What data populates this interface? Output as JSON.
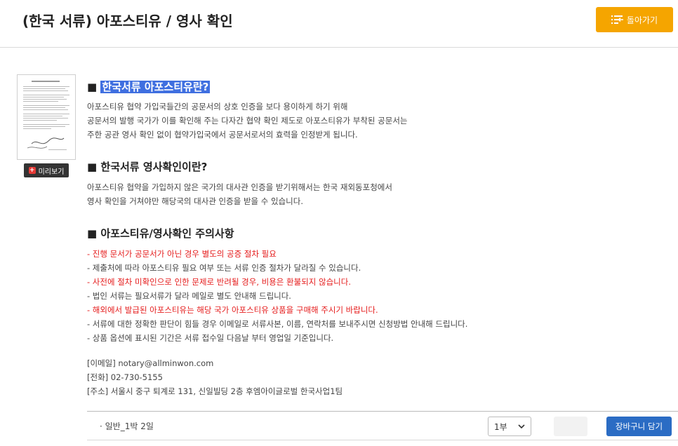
{
  "header": {
    "title": "(한국 서류) 아포스티유 / 영사 확인",
    "back_label": "돌아가기",
    "back_color": "#f5a500"
  },
  "thumbnail": {
    "preview_label": "미리보기",
    "icon": "document-thumbnail"
  },
  "sections": [
    {
      "title": "■ 한국서류 아포스티유란?",
      "title_prefix": "■ ",
      "title_highlight": "한국서류 아포스티유란?",
      "lines": [
        "아포스티유 협약 가입국들간의 공문서의 상호 인증을 보다 용이하게 하기 위해",
        "공문서의 발행 국가가 이를 확인해 주는 다자간 협약 확인 제도로 아포스티유가 부착된 공문서는",
        "주한 공관 영사 확인 없이 협약가입국에서 공문서로서의 효력을 인정받게 됩니다."
      ]
    },
    {
      "title": "■ 한국서류 영사확인이란?",
      "lines": [
        "아포스티유 협약을 가입하지 않은 국가의 대사관 인증을 받기위해서는 한국 재외동포청에서",
        "영사 확인을 거쳐야만 해당국의 대사관 인증을 받을 수 있습니다."
      ]
    },
    {
      "title": "■ 아포스티유/영사확인 주의사항"
    }
  ],
  "notes": [
    {
      "text": "- 진행 문서가 공문서가 아닌 경우 별도의 공증 절차 필요",
      "red": true
    },
    {
      "text": "- 제출처에 따라 아포스티유 필요 여부 또는 서류 인증 절차가 달라질 수 있습니다.",
      "red": false
    },
    {
      "text": "- 사전에 절차 미확인으로 인한 문제로 반려될 경우, 비용은 환불되지 않습니다.",
      "red": true
    },
    {
      "text": "- 법인 서류는 필요서류가 달라 메일로 별도 안내해 드립니다.",
      "red": false
    },
    {
      "text": "- 해외에서 발급된 아포스티유는 해당 국가 아포스티유 상품을 구매해 주시기 바랍니다.",
      "red": true
    },
    {
      "text": "- 서류에 대한 정확한 판단이 힘들 경우 이메일로 서류사본, 이름, 연락처를 보내주시면 신청방법 안내해 드립니다.",
      "red": false
    },
    {
      "text": "- 상품 옵션에 표시된 기간은 서류 접수일 다음날 부터 영업일 기준입니다.",
      "red": false
    }
  ],
  "contact": {
    "email": "[이메일] notary@allminwon.com",
    "phone": "[전화] 02-730-5155",
    "address": "[주소] 서울시 중구 퇴계로 131, 신일빌딩 2층 후엠아이글로벌 한국사업1팀"
  },
  "option_bar": {
    "option_name": "· 일반_1박 2일",
    "quantity_selected": "1부",
    "cart_label": "장바구니 담기",
    "cart_color": "#2b6cc4"
  }
}
